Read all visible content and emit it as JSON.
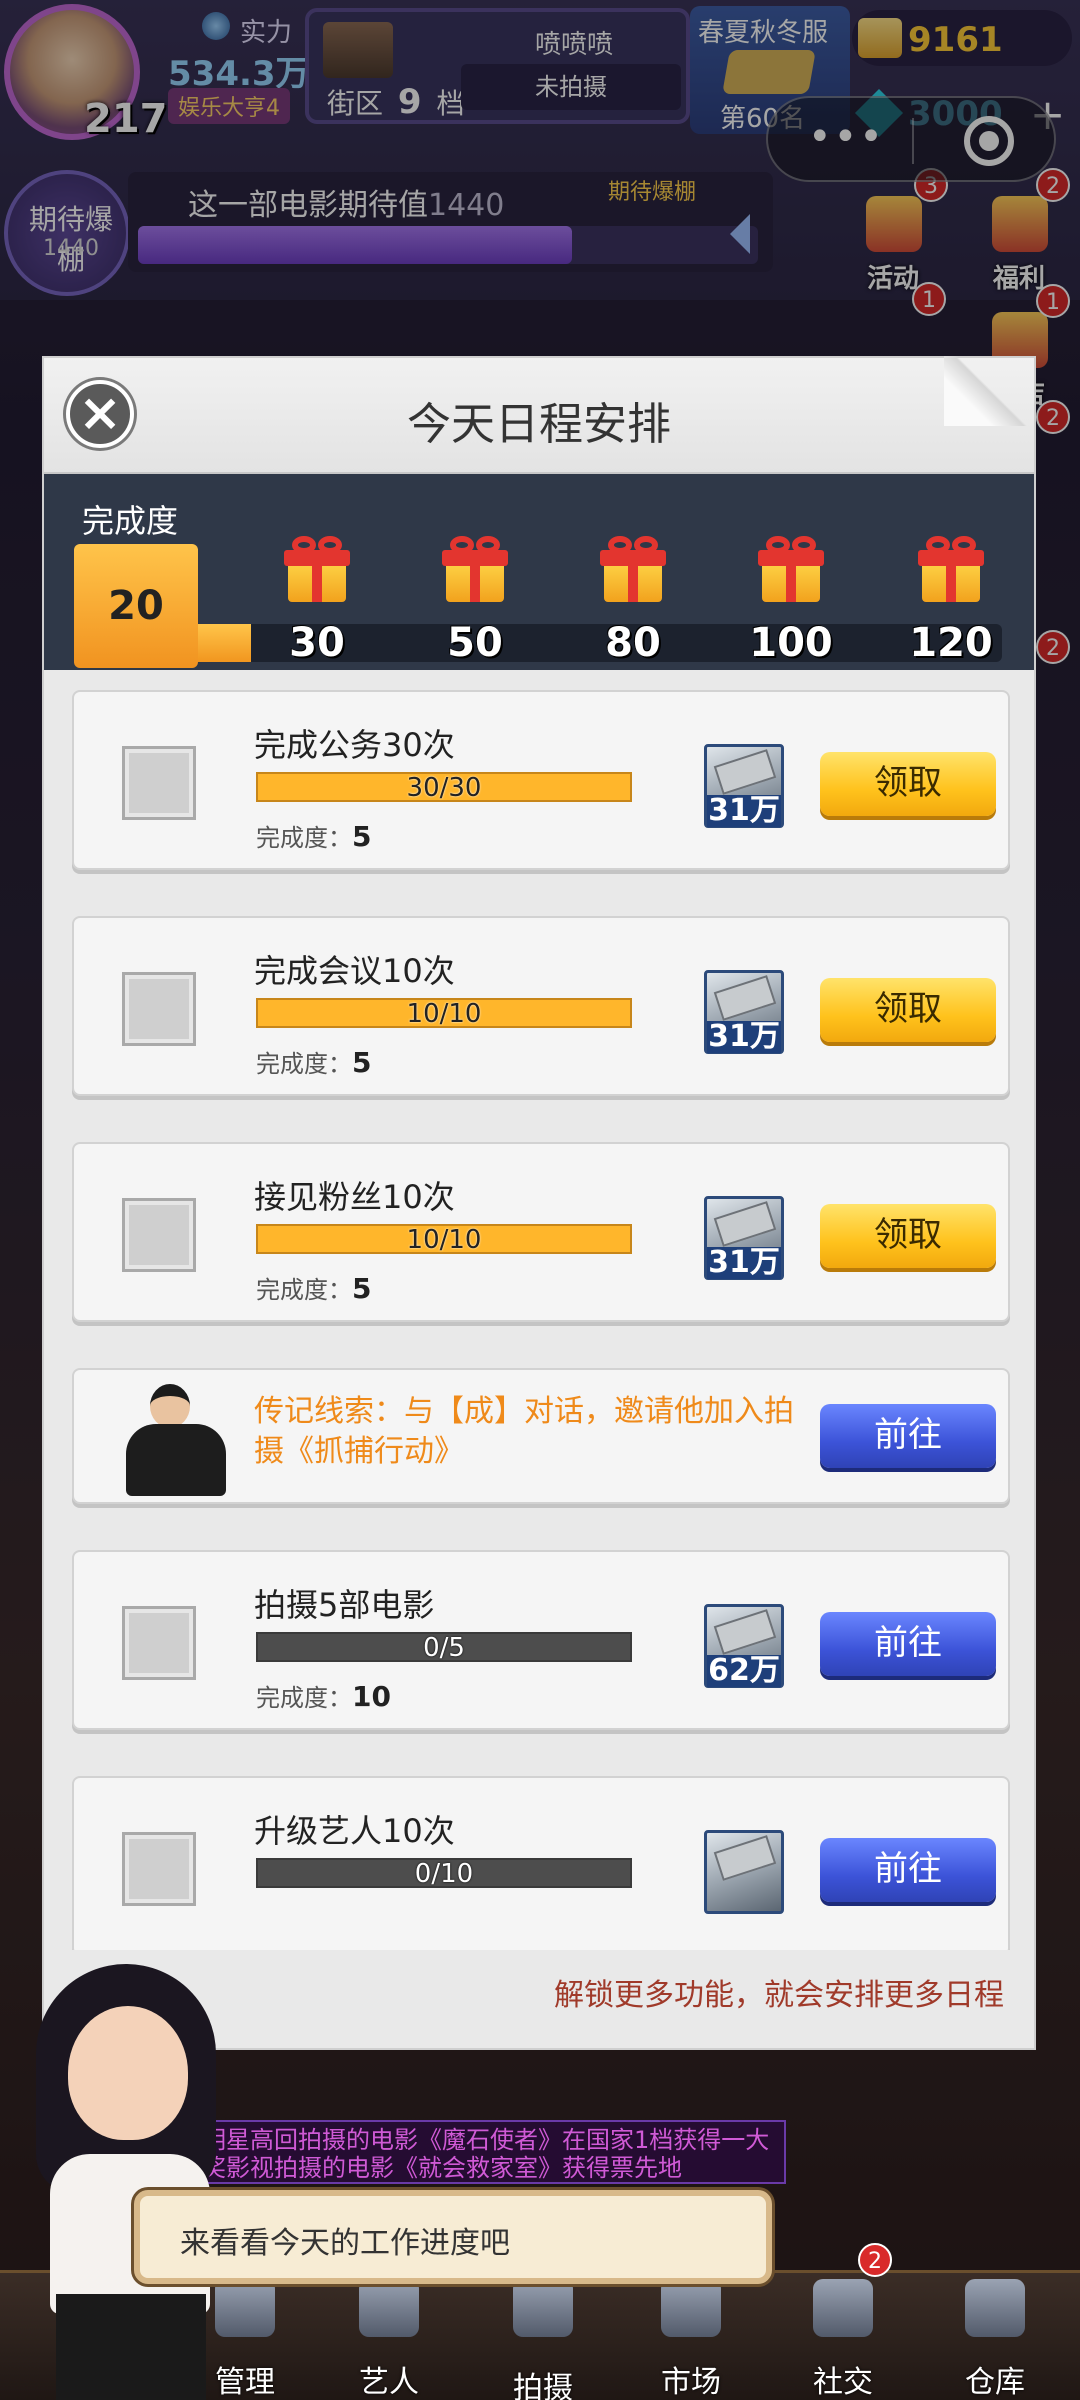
{
  "hud": {
    "level": "217",
    "power_label": "实力",
    "power_value": "534.3万",
    "power_rank": "娱乐大亨4",
    "district_label": "街区",
    "district_num": "9",
    "district_unit": "档",
    "district_title": "喷喷喷",
    "district_status": "未拍摄",
    "server_name": "春夏秋冬服",
    "server_rank": "第60名",
    "gold": "9161",
    "gems": "3000",
    "expect_badge_title": "期待爆棚",
    "expect_badge_num": "1440",
    "expect_text": "这一部电影期待值",
    "expect_value": "1440",
    "expect_marker": "期待爆棚",
    "expect_fill_percent": 70,
    "side_activity": "活动",
    "side_activity_badge": "3",
    "side_welfare": "福利",
    "side_welfare_badge": "2",
    "side_shop": "商店",
    "side_shop_badge": "1",
    "side_gift_badge": "1",
    "side_badge_a": "2",
    "side_badge_b": "2"
  },
  "dialog": {
    "title": "今天日程安排",
    "progress_label": "完成度",
    "progress_score": "20",
    "progress_fill_fraction": 0.07,
    "milestones": [
      "30",
      "50",
      "80",
      "100",
      "120"
    ],
    "footer": "解锁更多功能，就会安排更多日程"
  },
  "tasks": [
    {
      "title": "完成公务30次",
      "progress": "30/30",
      "points_label": "完成度：",
      "points": "5",
      "reward": "31万",
      "button": "领取"
    },
    {
      "title": "完成会议10次",
      "progress": "10/10",
      "points_label": "完成度：",
      "points": "5",
      "reward": "31万",
      "button": "领取"
    },
    {
      "title": "接见粉丝10次",
      "progress": "10/10",
      "points_label": "完成度：",
      "points": "5",
      "reward": "31万",
      "button": "领取"
    },
    {
      "bio_text": "传记线索：与【成】对话，邀请他加入拍摄《抓捕行动》",
      "button": "前往"
    },
    {
      "title": "拍摄5部电影",
      "progress": "0/5",
      "points_label": "完成度：",
      "points": "10",
      "reward": "62万",
      "button": "前往"
    },
    {
      "title": "升级艺人10次",
      "progress": "0/10",
      "button": "前往"
    }
  ],
  "guide": {
    "speech": "来看看今天的工作进度吧",
    "ticker": "明星高回拍摄的电影《魔石使者》在国家1档获得一大奖影视拍摄的电影《就会救家室》获得票先地"
  },
  "nav": {
    "manage": "管理",
    "artists": "艺人",
    "shoot": "拍摄",
    "market": "市场",
    "social": "社交",
    "social_badge": "2",
    "warehouse": "仓库"
  },
  "colors": {
    "claim_button": "#ffc21c",
    "go_button": "#3c53d8",
    "progress_fill": "#ffb62b",
    "bio_text": "#ef8a1a",
    "footer_text": "#a03a2a"
  }
}
